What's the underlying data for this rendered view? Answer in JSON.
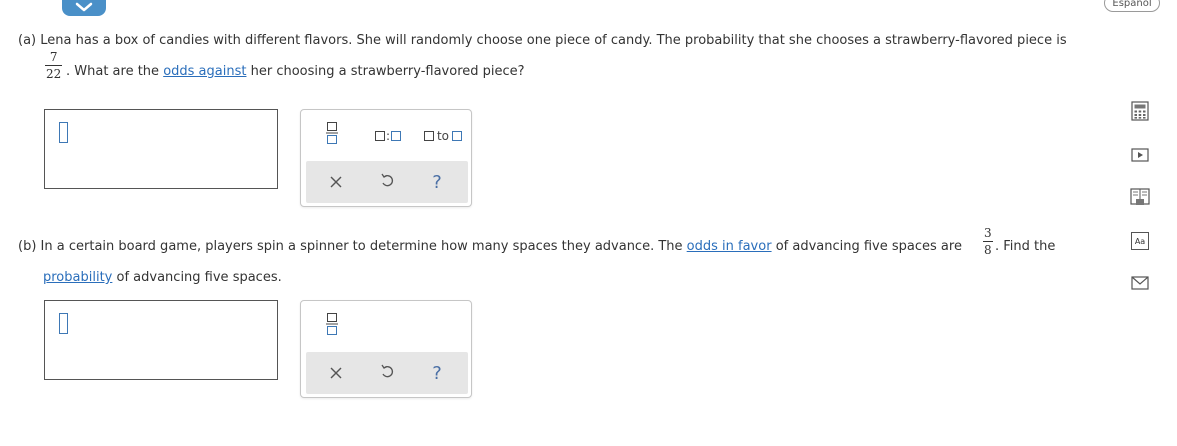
{
  "header": {
    "language_label": "Español"
  },
  "part_a": {
    "label": "(a)",
    "text_before": "Lena has a box of candies with different flavors. She will randomly choose one piece of candy. The probability that she chooses a strawberry-flavored piece is",
    "fraction_numerator": "7",
    "fraction_denominator": "22",
    "text_mid": ". What are the",
    "link": "odds against",
    "text_after": "her choosing a strawberry-flavored piece?",
    "tools": {
      "ratio_separator": ":",
      "to_word": "to",
      "help_symbol": "?"
    }
  },
  "part_b": {
    "label": "(b)",
    "text_before": "In a certain board game, players spin a spinner to determine how many spaces they advance. The",
    "link_1": "odds in favor",
    "text_mid": "of advancing five spaces are",
    "fraction_numerator": "3",
    "fraction_denominator": "8",
    "text_after": ". Find the",
    "link_2": "probability",
    "text_end": "of advancing five spaces.",
    "tools": {
      "help_symbol": "?"
    }
  },
  "sidebar": {
    "icons": [
      "calculator-icon",
      "play-video-icon",
      "textbook-icon",
      "glossary-icon",
      "email-icon"
    ],
    "glossary_label": "Aa"
  }
}
